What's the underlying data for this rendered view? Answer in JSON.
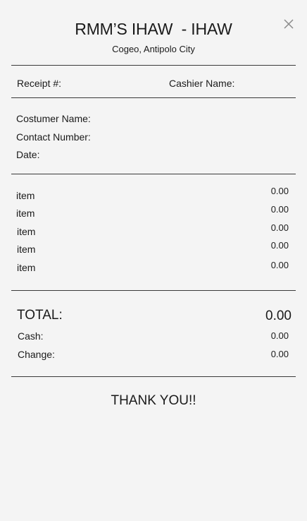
{
  "header": {
    "title": "RMM’S IHAW  - IHAW",
    "subtitle": "Cogeo, Antipolo City",
    "close_icon": "close-icon"
  },
  "receipt_info": {
    "receipt_label": "Receipt #:",
    "cashier_label": "Cashier Name:"
  },
  "customer": {
    "name_label": "Costumer Name:",
    "contact_label": "Contact Number:",
    "date_label": "Date:"
  },
  "items": [
    {
      "label": "item",
      "price": "0.00"
    },
    {
      "label": "item",
      "price": "0.00"
    },
    {
      "label": "item",
      "price": "0.00"
    },
    {
      "label": "item",
      "price": "0.00"
    },
    {
      "label": "item",
      "price": "0.00"
    }
  ],
  "totals": {
    "total_label": "TOTAL:",
    "total_value": "0.00",
    "cash_label": "Cash:",
    "cash_value": "0.00",
    "change_label": "Change:",
    "change_value": "0.00"
  },
  "footer": {
    "thanks": "THANK YOU!!"
  }
}
